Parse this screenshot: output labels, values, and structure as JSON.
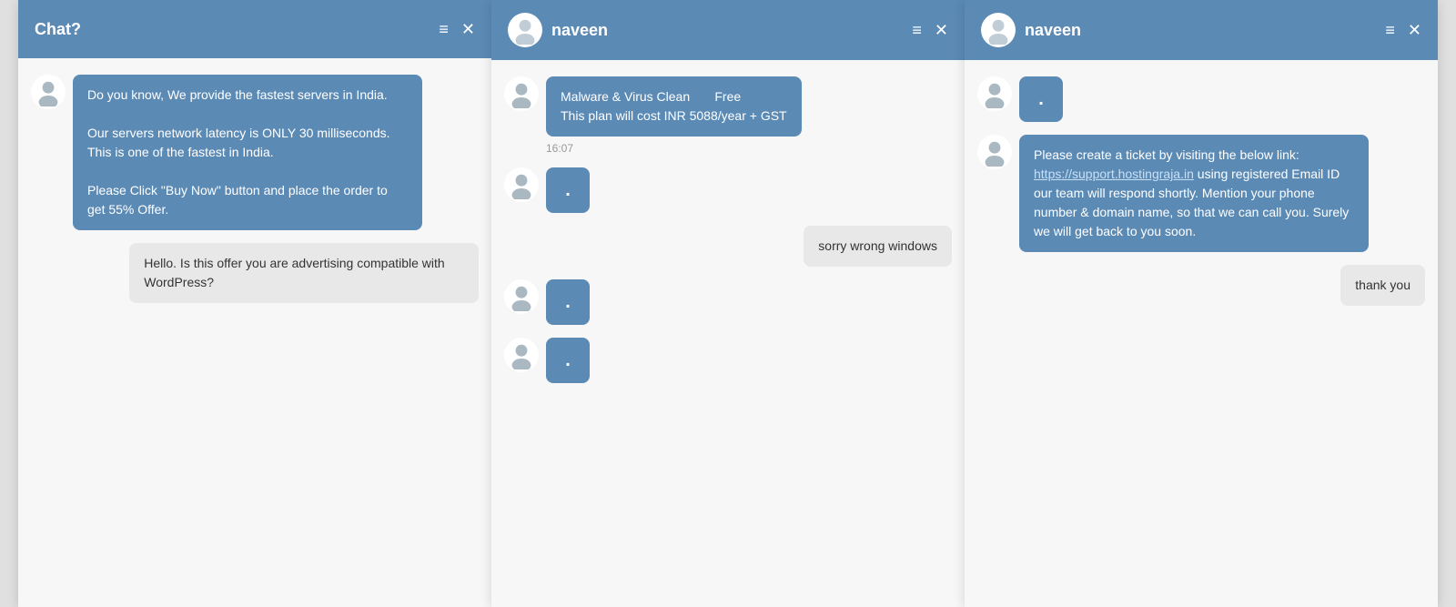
{
  "window1": {
    "title": "Chat?",
    "messages": [
      {
        "type": "agent",
        "text": "Do you know, We provide the fastest servers in India.\n\nOur servers network latency is ONLY 30 milliseconds. This is one of the fastest in India.\n\nPlease Click \"Buy Now\" button and place the order to get 55% Offer.",
        "dot": false
      },
      {
        "type": "user",
        "text": "Hello. Is this offer you are advertising compatible with WordPress?",
        "dot": false
      }
    ],
    "icons": {
      "menu": "≡",
      "close": "✕"
    }
  },
  "window2": {
    "title": "naveen",
    "messages": [
      {
        "type": "agent",
        "text": "Malware & Virus Clean       Free\nThis plan will cost INR 5088/year + GST",
        "dot": false,
        "timestamp": "16:07"
      },
      {
        "type": "agent",
        "dot": true,
        "text": "."
      },
      {
        "type": "user",
        "text": "sorry wrong windows",
        "dot": false
      },
      {
        "type": "agent",
        "dot": true,
        "text": "."
      },
      {
        "type": "agent",
        "dot": true,
        "text": "."
      }
    ],
    "icons": {
      "menu": "≡",
      "close": "✕"
    }
  },
  "window3": {
    "title": "naveen",
    "messages": [
      {
        "type": "agent",
        "dot": true,
        "text": "."
      },
      {
        "type": "agent",
        "text": "Please create a ticket by visiting the below link: https://support.hostingraja.in using registered Email ID our team will respond shortly. Mention your phone number & domain name, so that we can call you. Surely we will get back to you soon.",
        "dot": false,
        "link": "https://support.hostingraja.in"
      },
      {
        "type": "user",
        "text": "thank you",
        "dot": false
      }
    ],
    "icons": {
      "menu": "≡",
      "close": "✕"
    }
  }
}
